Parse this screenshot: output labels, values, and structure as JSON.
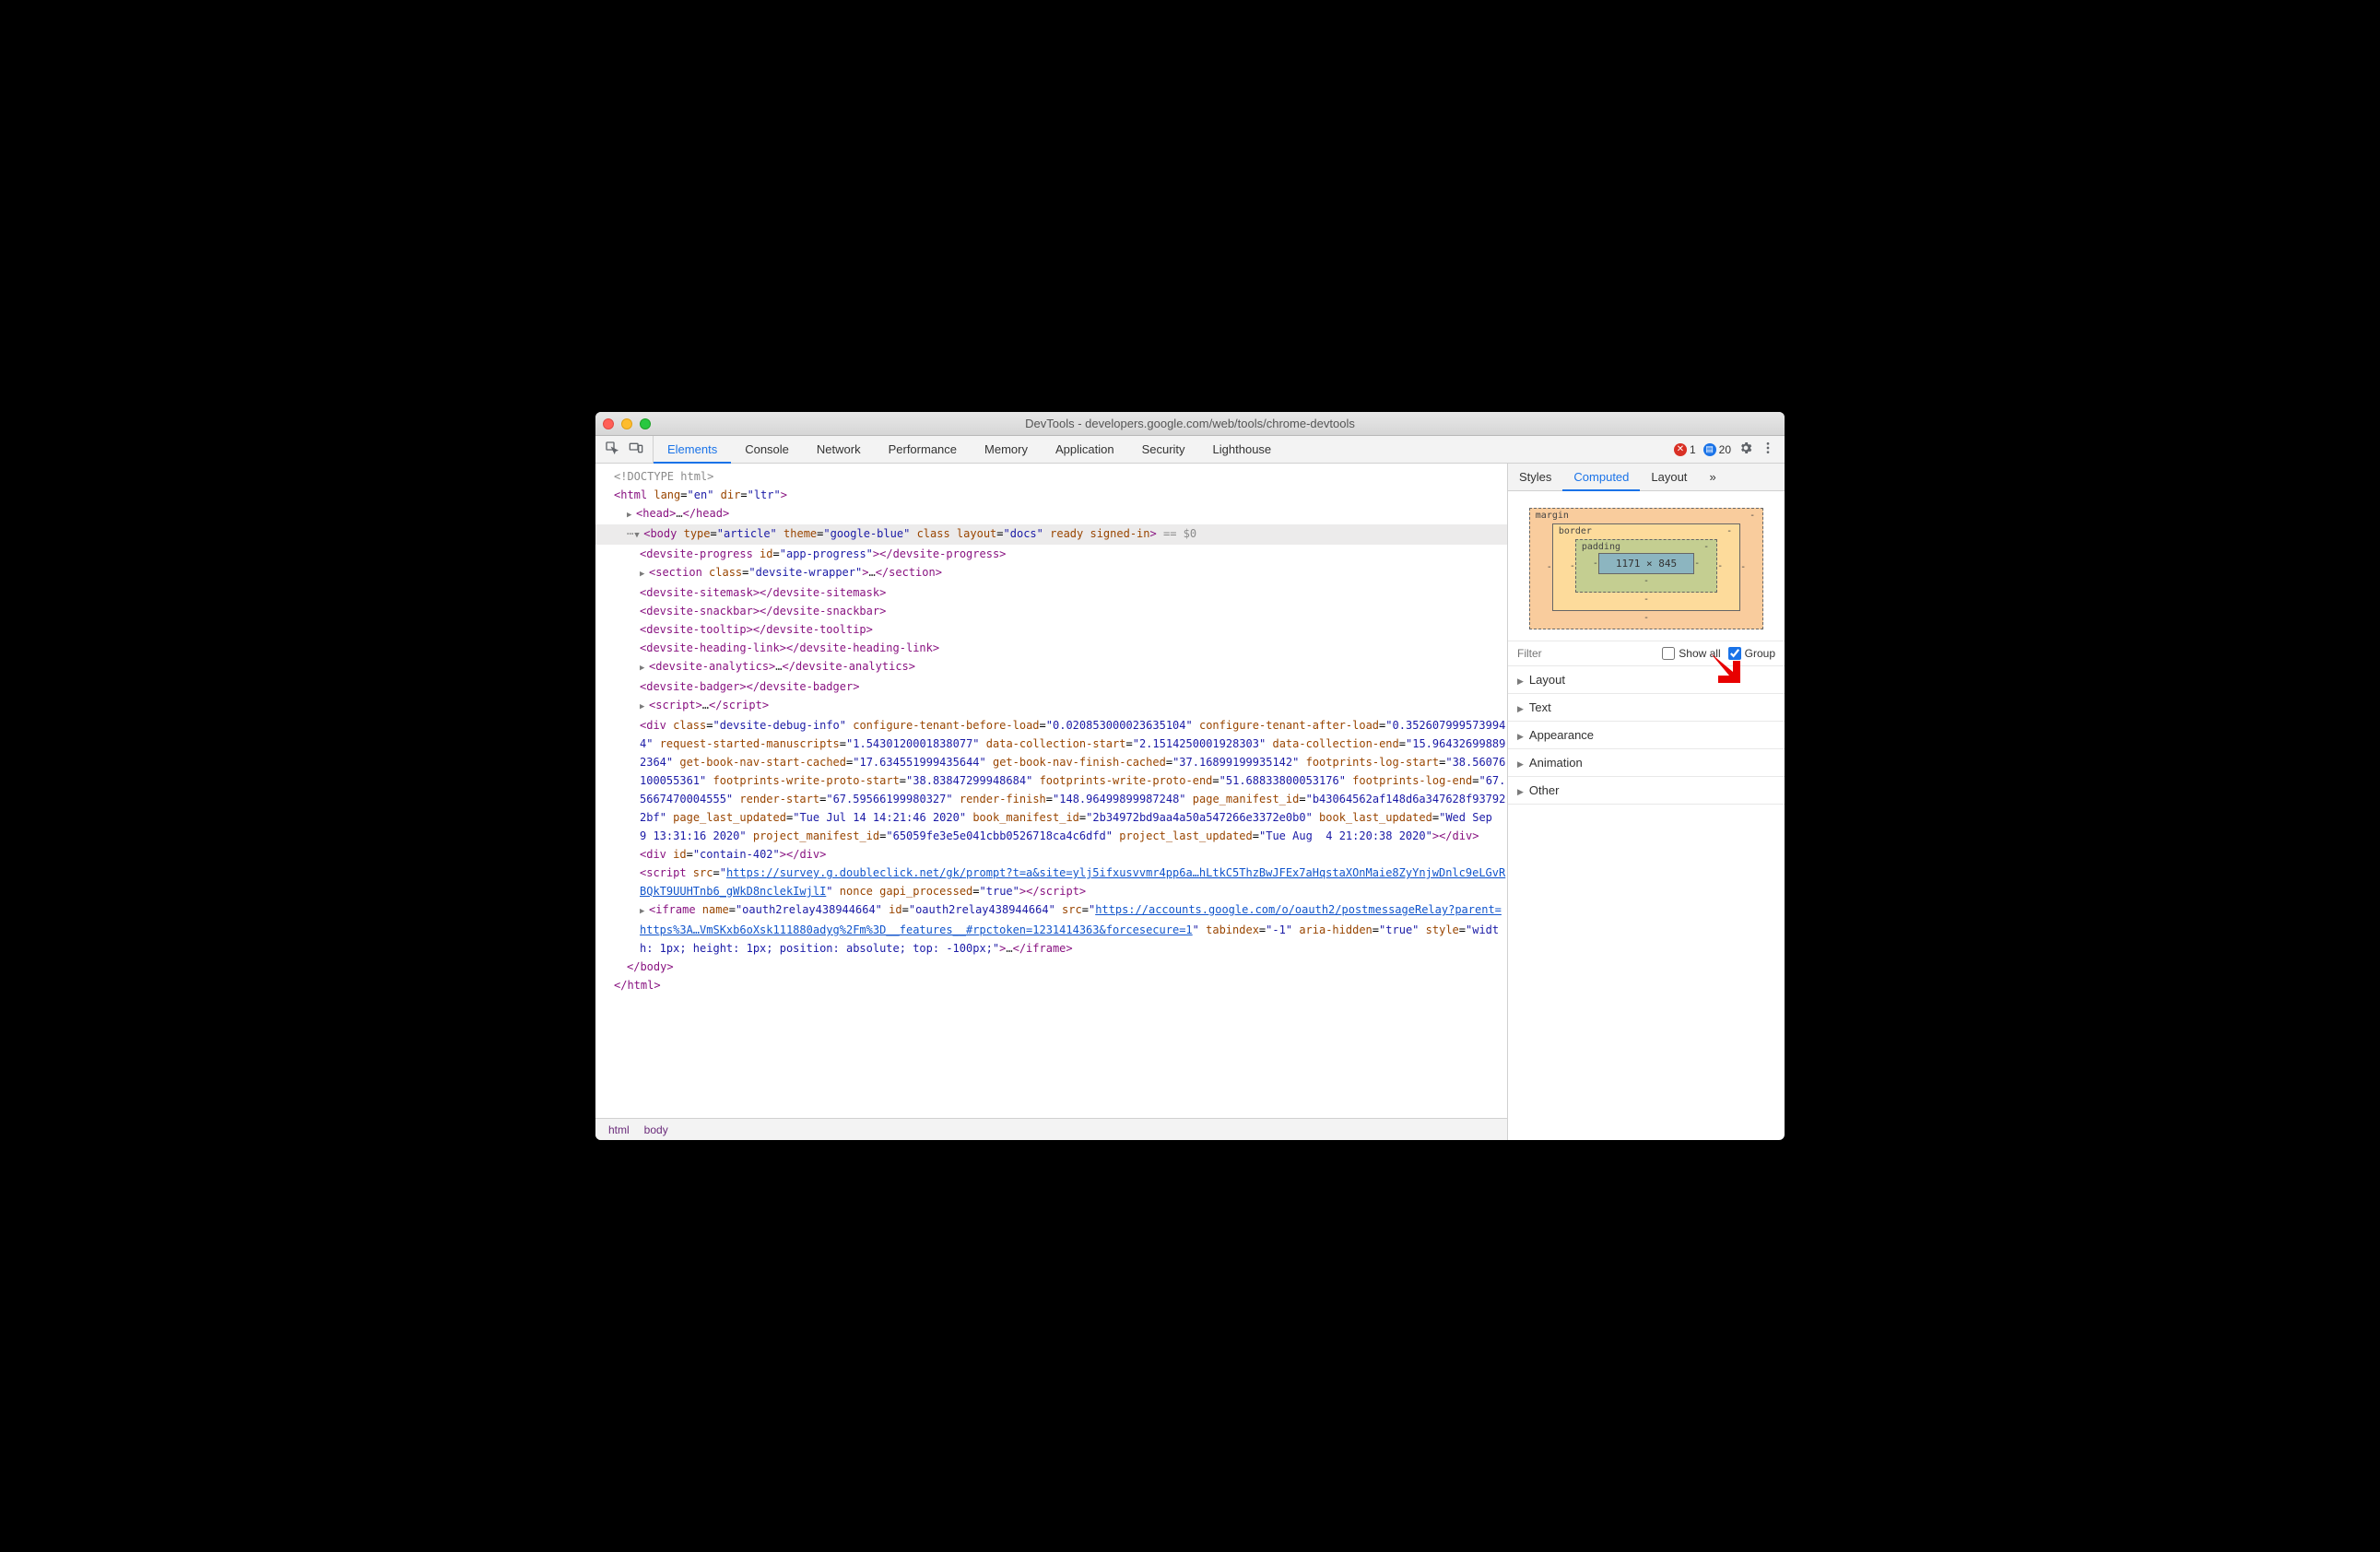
{
  "window": {
    "title": "DevTools - developers.google.com/web/tools/chrome-devtools"
  },
  "toolbar": {
    "tabs": [
      "Elements",
      "Console",
      "Network",
      "Performance",
      "Memory",
      "Application",
      "Security",
      "Lighthouse"
    ],
    "active_tab": "Elements",
    "errors": {
      "red_count": "1",
      "blue_count": "20"
    }
  },
  "dom": {
    "line0": "<!DOCTYPE html>",
    "line1_open": "<html ",
    "line1_attrs": [
      [
        "lang",
        "en"
      ],
      [
        "dir",
        "ltr"
      ]
    ],
    "line1_close": ">",
    "line2_head_open": "<head>",
    "line2_ellipsis": "…",
    "line2_head_close": "</head>",
    "line3_body_open": "<body ",
    "line3_body_attrs": [
      [
        "type",
        "article"
      ],
      [
        "theme",
        "google-blue"
      ],
      [
        "class",
        ""
      ],
      [
        "layout",
        "docs"
      ],
      [
        "ready",
        ""
      ],
      [
        "signed-in",
        ""
      ]
    ],
    "line3_after": " == $0",
    "line4": {
      "open": "<devsite-progress ",
      "attrs": [
        [
          "id",
          "app-progress"
        ]
      ],
      "mid": ">",
      "end": "</devsite-progress>"
    },
    "line5": {
      "open": "<section ",
      "attrs": [
        [
          "class",
          "devsite-wrapper"
        ]
      ],
      "mid": ">",
      "ell": "…",
      "end": "</section>"
    },
    "line6": "<devsite-sitemask></devsite-sitemask>",
    "line7": "<devsite-snackbar></devsite-snackbar>",
    "line8": "<devsite-tooltip></devsite-tooltip>",
    "line9": "<devsite-heading-link></devsite-heading-link>",
    "line10": {
      "open": "<devsite-analytics>",
      "ell": "…",
      "end": "</devsite-analytics>"
    },
    "line11": "<devsite-badger></devsite-badger>",
    "line12": {
      "open": "<script>",
      "ell": "…",
      "end": "</script>"
    },
    "line13_open": "<div ",
    "line13_attrs": [
      [
        "class",
        "devsite-debug-info"
      ],
      [
        "configure-tenant-before-load",
        "0.020853000023635104"
      ],
      [
        "configure-tenant-after-load",
        "0.3526079995739944"
      ],
      [
        "request-started-manuscripts",
        "1.5430120001838077"
      ],
      [
        "data-collection-start",
        "2.1514250001928303"
      ],
      [
        "data-collection-end",
        "15.964326998892364"
      ],
      [
        "get-book-nav-start-cached",
        "17.634551999435644"
      ],
      [
        "get-book-nav-finish-cached",
        "37.16899199935142"
      ],
      [
        "footprints-log-start",
        "38.56076100055361"
      ],
      [
        "footprints-write-proto-start",
        "38.83847299948684"
      ],
      [
        "footprints-write-proto-end",
        "51.68833800053176"
      ],
      [
        "footprints-log-end",
        "67.5667470004555"
      ],
      [
        "render-start",
        "67.59566199980327"
      ],
      [
        "render-finish",
        "148.96499899987248"
      ],
      [
        "page_manifest_id",
        "b43064562af148d6a347628f937922bf"
      ],
      [
        "page_last_updated",
        "Tue Jul 14 14:21:46 2020"
      ],
      [
        "book_manifest_id",
        "2b34972bd9aa4a50a547266e3372e0b0"
      ],
      [
        "book_last_updated",
        "Wed Sep  9 13:31:16 2020"
      ],
      [
        "project_manifest_id",
        "65059fe3e5e041cbb0526718ca4c6dfd"
      ],
      [
        "project_last_updated",
        "Tue Aug  4 21:20:38 2020"
      ]
    ],
    "line13_close": "></div>",
    "line14": {
      "open": "<div ",
      "attrs": [
        [
          "id",
          "contain-402"
        ]
      ],
      "close": "></div>"
    },
    "line15_open": "<script ",
    "line15_src_attr": "src",
    "line15_src_val": "https://survey.g.doubleclick.net/gk/prompt?t=a&site=ylj5ifxusvvmr4pp6a…hLtkC5ThzBwJFEx7aHqstaXOnMaie8ZyYnjwDnlc9eLGvRBQkT9UUHTnb6_gWkD8nclekIwjlI",
    "line15_attrs_after": [
      [
        "nonce",
        ""
      ],
      [
        "gapi_processed",
        "true"
      ]
    ],
    "line15_mid": ">",
    "line15_close": "</script>",
    "line16_open": "<iframe ",
    "line16_attrs_pre": [
      [
        "name",
        "oauth2relay438944664"
      ],
      [
        "id",
        "oauth2relay438944664"
      ]
    ],
    "line16_src_attr": "src",
    "line16_src_val": "https://accounts.google.com/o/oauth2/postmessageRelay?parent=https%3A…VmSKxb6oXsk111880adyg%2Fm%3D__features__#rpctoken=1231414363&forcesecure=1",
    "line16_attrs_post": [
      [
        "tabindex",
        "-1"
      ],
      [
        "aria-hidden",
        "true"
      ],
      [
        "style",
        "width: 1px; height: 1px; position: absolute; top: -100px;"
      ]
    ],
    "line16_mid": ">",
    "line16_ell": "…",
    "line16_close": "</iframe>",
    "line17": "</body>",
    "line18": "</html>"
  },
  "breadcrumb": [
    "html",
    "body"
  ],
  "sidebar": {
    "tabs": [
      "Styles",
      "Computed",
      "Layout"
    ],
    "active_tab": "Computed",
    "box_model": {
      "margin": "margin",
      "border": "border",
      "padding": "padding",
      "content": "1171 × 845",
      "dash": "-"
    },
    "filter": {
      "placeholder": "Filter",
      "show_all": "Show all",
      "group": "Group"
    },
    "sections": [
      "Layout",
      "Text",
      "Appearance",
      "Animation",
      "Other"
    ]
  }
}
